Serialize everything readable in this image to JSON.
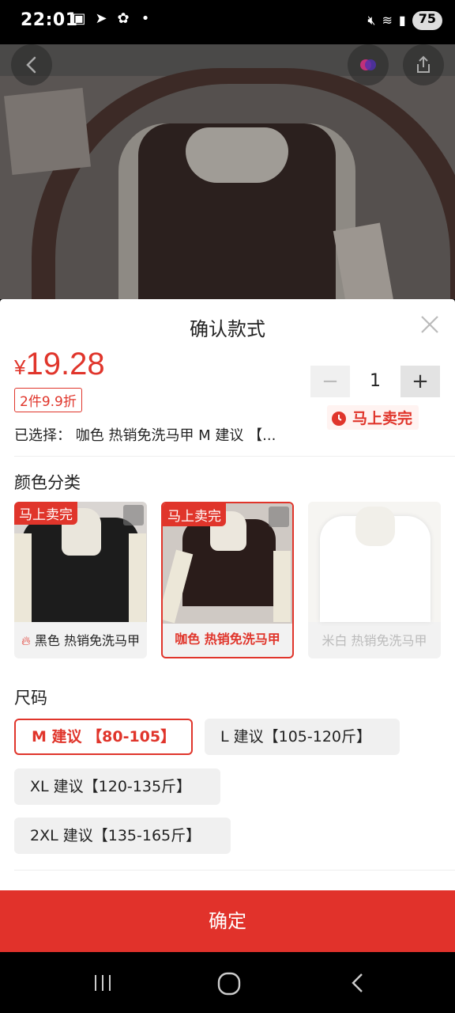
{
  "status_bar": {
    "time": "22:01",
    "battery": "75"
  },
  "header": {
    "back_icon": "back-arrow-icon",
    "share_icon": "share-icon"
  },
  "sheet": {
    "title": "确认款式",
    "price_currency": "¥",
    "price_value": "19.28",
    "promo_tag": "2件9.9折",
    "quantity": "1",
    "selling_fast": "马上卖完",
    "selected_label": "已选择：",
    "selected_value": "咖色 热销免洗马甲 M 建议 【..."
  },
  "color_section": {
    "title": "颜色分类",
    "options": [
      {
        "label": "黑色 热销免洗马甲",
        "badge": "马上卖完",
        "state": "normal"
      },
      {
        "label": "咖色 热销免洗马甲",
        "badge": "马上卖完",
        "state": "selected"
      },
      {
        "label": "米白 热销免洗马甲",
        "badge": "",
        "state": "disabled"
      }
    ]
  },
  "size_section": {
    "title": "尺码",
    "options": [
      {
        "label": "M 建议 【80-105】",
        "state": "selected"
      },
      {
        "label": "L 建议【105-120斤】",
        "state": "normal"
      },
      {
        "label": "XL 建议【120-135斤】",
        "state": "normal"
      },
      {
        "label": "2XL 建议【135-165斤】",
        "state": "normal"
      }
    ]
  },
  "confirm_button": "确定",
  "colors": {
    "accent": "#e1322b"
  }
}
